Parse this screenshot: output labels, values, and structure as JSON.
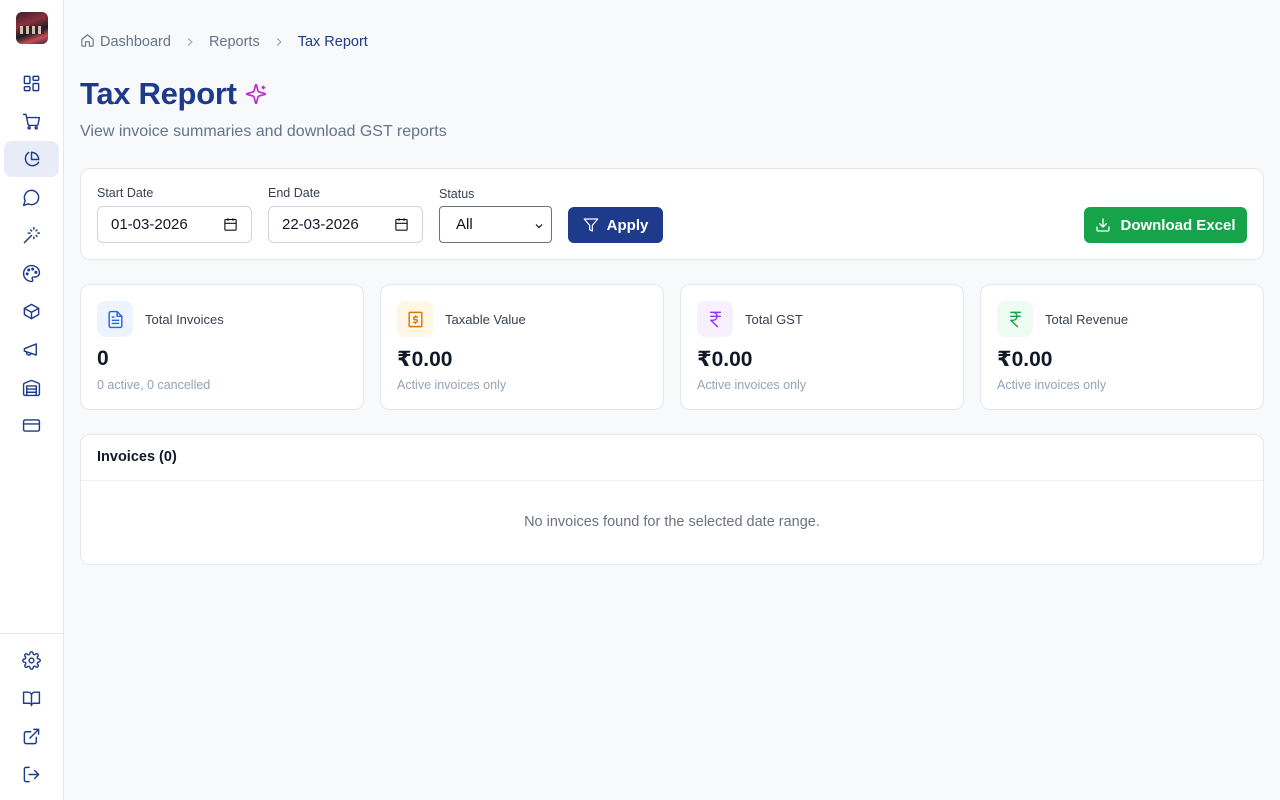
{
  "sidebar": {
    "logo": "store-logo",
    "nav": [
      {
        "icon": "dashboard-icon",
        "active": false
      },
      {
        "icon": "cart-icon",
        "active": false
      },
      {
        "icon": "pie-chart-icon",
        "active": true
      },
      {
        "icon": "message-icon",
        "active": false
      },
      {
        "icon": "magic-wand-icon",
        "active": false
      },
      {
        "icon": "palette-icon",
        "active": false
      },
      {
        "icon": "package-icon",
        "active": false
      },
      {
        "icon": "megaphone-icon",
        "active": false
      },
      {
        "icon": "warehouse-icon",
        "active": false
      },
      {
        "icon": "credit-card-icon",
        "active": false
      }
    ],
    "bottom_nav": [
      {
        "icon": "settings-icon"
      },
      {
        "icon": "book-icon"
      },
      {
        "icon": "external-link-icon"
      },
      {
        "icon": "logout-icon"
      }
    ]
  },
  "breadcrumb": {
    "items": [
      "Dashboard",
      "Reports",
      "Tax Report"
    ]
  },
  "header": {
    "title": "Tax Report",
    "subtitle": "View invoice summaries and download GST reports"
  },
  "filters": {
    "start_date_label": "Start Date",
    "start_date_value": "01-03-2026",
    "end_date_label": "End Date",
    "end_date_value": "22-03-2026",
    "status_label": "Status",
    "status_value": "All",
    "apply_label": "Apply",
    "download_label": "Download Excel"
  },
  "stats": [
    {
      "label": "Total Invoices",
      "value": "0",
      "sub": "0 active, 0 cancelled",
      "icon": "document-icon",
      "color": "#2563eb",
      "bg": "#eef4ff"
    },
    {
      "label": "Taxable Value",
      "value": "₹0.00",
      "sub": "Active invoices only",
      "icon": "dollar-receipt-icon",
      "color": "#d97706",
      "bg": "#fff7e6"
    },
    {
      "label": "Total GST",
      "value": "₹0.00",
      "sub": "Active invoices only",
      "icon": "rupee-icon",
      "color": "#9333ea",
      "bg": "#f8efff"
    },
    {
      "label": "Total Revenue",
      "value": "₹0.00",
      "sub": "Active invoices only",
      "icon": "rupee-icon",
      "color": "#16a34a",
      "bg": "#eefbf2"
    }
  ],
  "invoices": {
    "title": "Invoices (0)",
    "empty_text": "No invoices found for the selected date range."
  },
  "colors": {
    "brand": "#1e3a8a",
    "success": "#16a34a",
    "accent": "#c026d3"
  }
}
